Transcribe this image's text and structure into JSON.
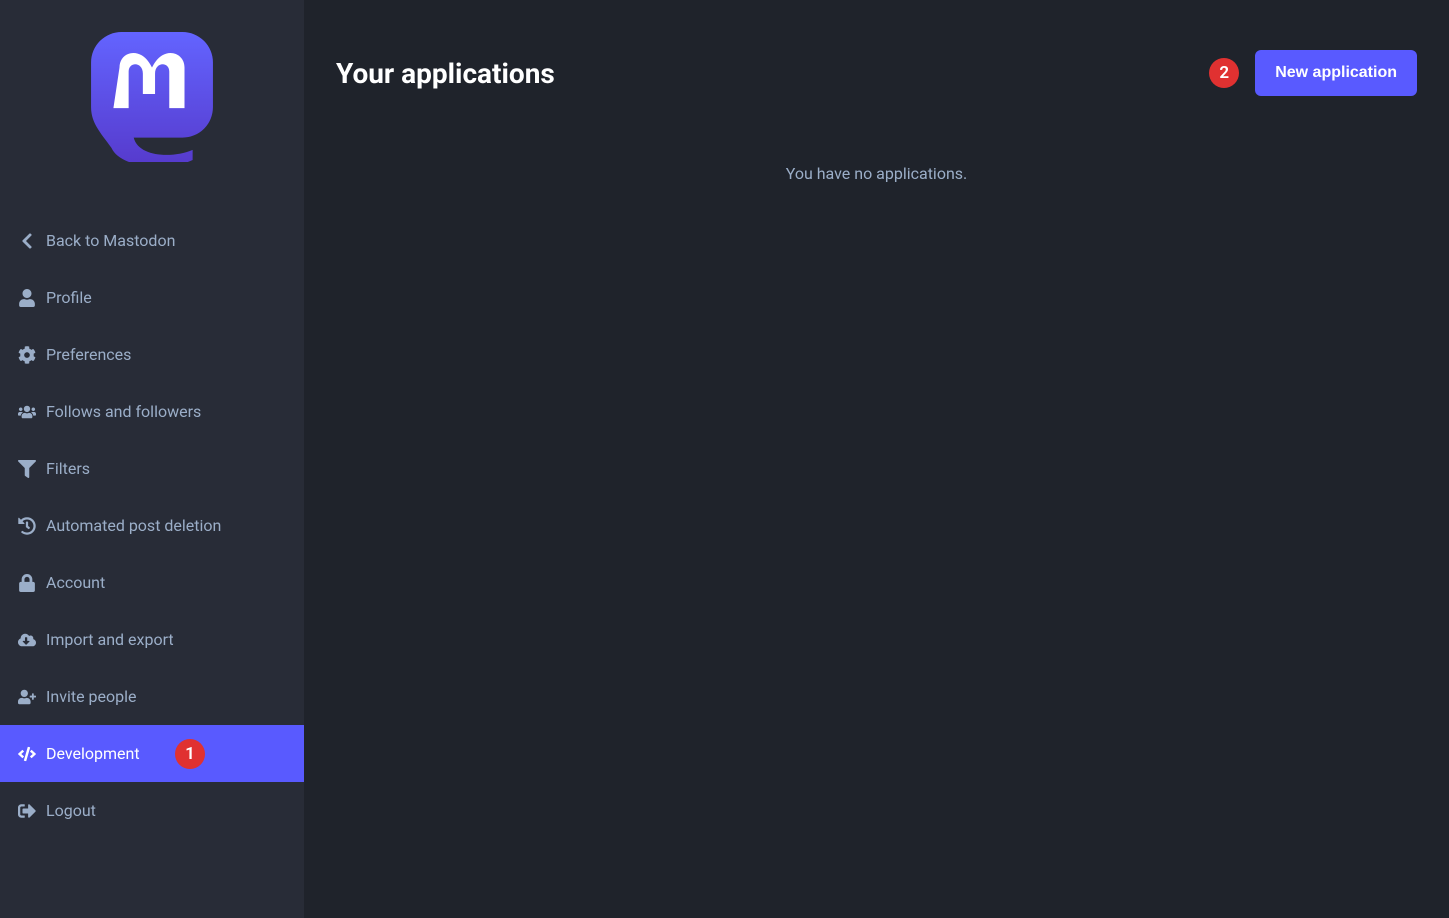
{
  "sidebar": {
    "items": [
      {
        "label": "Back to Mastodon"
      },
      {
        "label": "Profile"
      },
      {
        "label": "Preferences"
      },
      {
        "label": "Follows and followers"
      },
      {
        "label": "Filters"
      },
      {
        "label": "Automated post deletion"
      },
      {
        "label": "Account"
      },
      {
        "label": "Import and export"
      },
      {
        "label": "Invite people"
      },
      {
        "label": "Development"
      },
      {
        "label": "Logout"
      }
    ]
  },
  "header": {
    "title": "Your applications",
    "new_button": "New application"
  },
  "main": {
    "empty_message": "You have no applications."
  },
  "annotations": {
    "badge1": "1",
    "badge2": "2"
  }
}
